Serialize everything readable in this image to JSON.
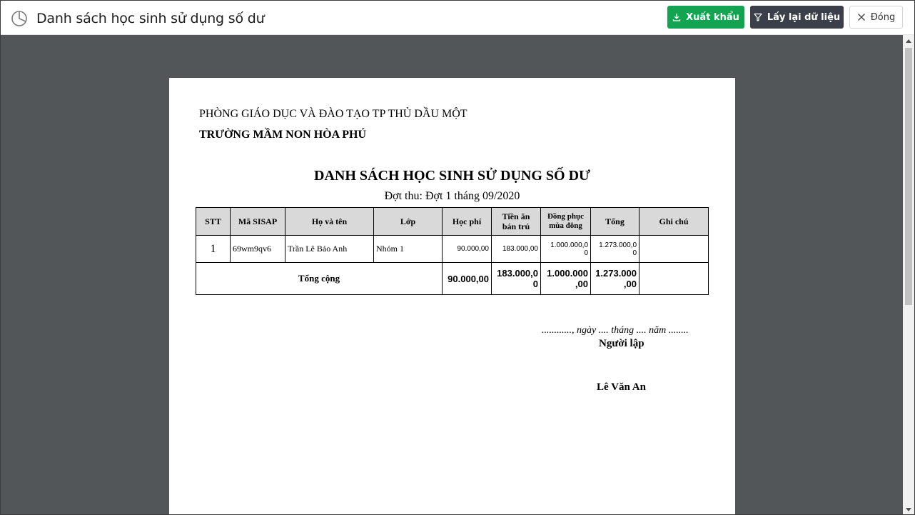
{
  "header": {
    "title": "Danh sách học sinh sử dụng số dư",
    "app_icon": "pie-chart-icon",
    "export_label": "Xuất khẩu",
    "reload_label": "Lấy lại dữ liệu",
    "close_label": "Đóng"
  },
  "colors": {
    "export_button": "#12a451",
    "reload_button": "#3b3f4a",
    "viewer_background": "#535659",
    "table_header": "#d9d9d9"
  },
  "report": {
    "org_line1": "PHÒNG GIÁO DỤC VÀ ĐÀO TẠO TP THỦ DẦU MỘT",
    "org_line2": "TRƯỜNG MẦM NON HÒA PHÚ",
    "title": "DANH SÁCH HỌC SINH SỬ DỤNG SỐ DƯ",
    "subtitle": "Đợt thu: Đợt 1 tháng 09/2020",
    "columns": {
      "stt": "STT",
      "sisap": "Mã SISAP",
      "name": "Họ và tên",
      "class": "Lớp",
      "tuition": "Học phí",
      "meal_line1": "Tiền ăn",
      "meal_line2": "bán trú",
      "uniform_line1": "Đồng phục",
      "uniform_line2": "mùa đông",
      "total": "Tổng",
      "note": "Ghi chú"
    },
    "rows": [
      {
        "stt": "1",
        "sisap": "69wm9qv6",
        "name": "Trần Lê Bảo Anh",
        "class": "Nhóm 1",
        "tuition": "90.000,00",
        "meal": "183.000,00",
        "uniform_line1": "1.000.000,0",
        "uniform_line2": "0",
        "total_line1": "1.273.000,0",
        "total_line2": "0",
        "note": ""
      }
    ],
    "totals": {
      "label": "Tổng cộng",
      "tuition": "90.000,00",
      "meal_line1": "183.000,0",
      "meal_line2": "0",
      "uniform_line1": "1.000.000",
      "uniform_line2": ",00",
      "total_line1": "1.273.000",
      "total_line2": ",00",
      "note": ""
    },
    "signature": {
      "date_line": "............, ngày .... tháng .... năm ........",
      "role": "Người lập",
      "name": "Lê Văn An"
    }
  }
}
